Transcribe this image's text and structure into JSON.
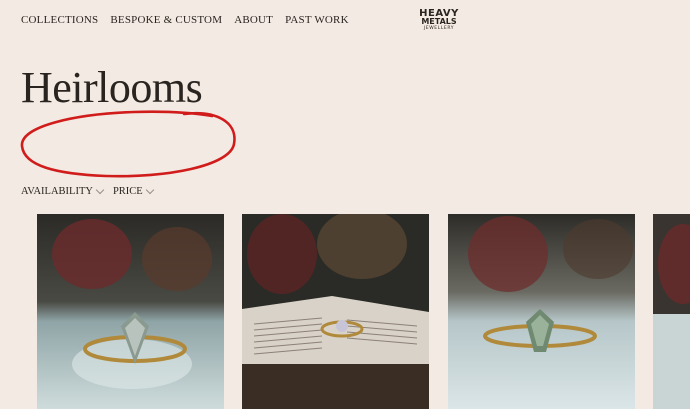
{
  "nav": {
    "items": [
      {
        "label": "COLLECTIONS"
      },
      {
        "label": "BESPOKE & CUSTOM"
      },
      {
        "label": "ABOUT"
      },
      {
        "label": "PAST WORK"
      }
    ]
  },
  "logo": {
    "line1": "HEAVY",
    "line2": "METALS",
    "line3": "JEWELLERY"
  },
  "page": {
    "title": "Heirlooms"
  },
  "filters": [
    {
      "label": "AVAILABILITY"
    },
    {
      "label": "PRICE"
    }
  ],
  "colors": {
    "background": "#f3ebe3",
    "scribble": "#d11c1c",
    "text": "#2a2420"
  },
  "products": [
    {
      "image": "ring-photo-gold-grey-stone"
    },
    {
      "image": "ring-photo-on-open-book"
    },
    {
      "image": "ring-photo-gold-green-shield-stone"
    },
    {
      "image": "ring-photo-partial"
    }
  ]
}
